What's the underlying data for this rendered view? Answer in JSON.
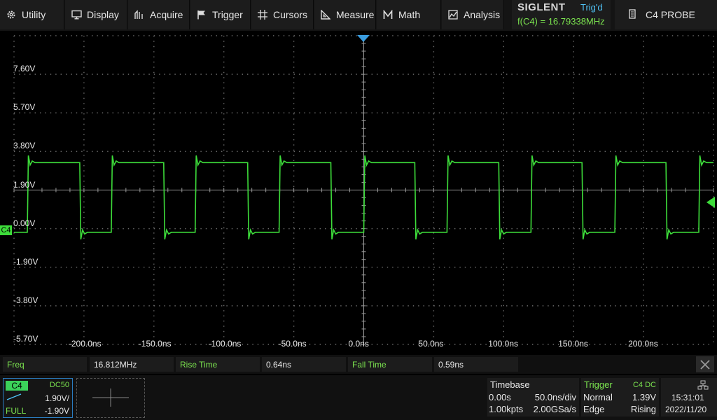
{
  "menu": {
    "items": [
      {
        "label": "Utility",
        "icon": "gear-icon"
      },
      {
        "label": "Display",
        "icon": "monitor-icon"
      },
      {
        "label": "Acquire",
        "icon": "acquire-icon"
      },
      {
        "label": "Trigger",
        "icon": "flag-icon"
      },
      {
        "label": "Cursors",
        "icon": "crosshair-icon"
      },
      {
        "label": "Measure",
        "icon": "ruler-icon"
      },
      {
        "label": "Math",
        "icon": "math-icon"
      },
      {
        "label": "Analysis",
        "icon": "analysis-icon"
      }
    ],
    "brand": "SIGLENT",
    "trigger_status": "Trig'd",
    "frequency_counter": "f(C4) = 16.79338MHz",
    "probe_label": "C4 PROBE"
  },
  "axes": {
    "y_labels": [
      "7.60V",
      "5.70V",
      "3.80V",
      "1.90V",
      "0.00V",
      "-1.90V",
      "-3.80V",
      "-5.70V"
    ],
    "x_labels": [
      "-200.0ns",
      "-150.0ns",
      "-100.0ns",
      "-50.0ns",
      "0.0ns",
      "50.0ns",
      "100.0ns",
      "150.0ns",
      "200.0ns"
    ],
    "channel_marker": "C4"
  },
  "chart_data": {
    "type": "line",
    "series": [
      {
        "name": "C4",
        "color": "#3ddc3a"
      }
    ],
    "x_range_ns": [
      -250,
      250
    ],
    "y_range_v": [
      -5.7,
      9.5
    ],
    "high_level_v": 3.25,
    "low_level_v": -0.18,
    "rising_edges_ns": [
      -240.5,
      -180.5,
      -120.5,
      -60.5,
      0.0,
      59.5,
      119.5,
      179.5,
      239.5
    ],
    "falling_edges_ns": [
      -203.0,
      -143.0,
      -83.0,
      -23.5,
      36.5,
      96.5,
      156.0,
      216.0
    ],
    "grid": true
  },
  "measurements": {
    "items": [
      {
        "name": "Freq",
        "value": "16.812MHz"
      },
      {
        "name": "Rise Time",
        "value": "0.64ns"
      },
      {
        "name": "Fall Time",
        "value": "0.59ns"
      }
    ]
  },
  "channel": {
    "name": "C4",
    "coupling": "DC50",
    "scale": "1.90V/",
    "bandwidth": "FULL",
    "offset": "-1.90V"
  },
  "timebase": {
    "title": "Timebase",
    "delay": "0.00s",
    "scale": "50.0ns/div",
    "memory": "1.00kpts",
    "sample_rate": "2.00GSa/s"
  },
  "trigger": {
    "title": "Trigger",
    "source": "C4 DC",
    "mode": "Normal",
    "level": "1.39V",
    "type": "Edge",
    "slope": "Rising"
  },
  "clock": {
    "time": "15:31:01",
    "date": "2022/11/20"
  },
  "colors": {
    "trace": "#3ddc3a",
    "accent_green": "#7be34f",
    "trigger_blue": "#4fc3f7"
  }
}
